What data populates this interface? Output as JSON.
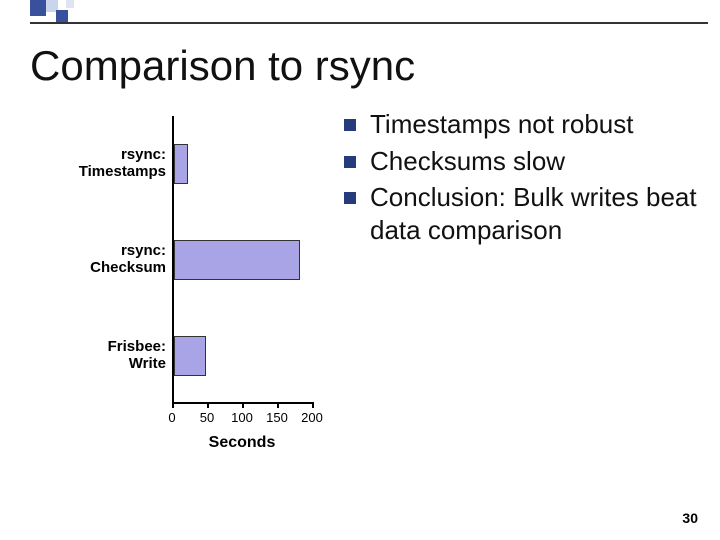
{
  "slide": {
    "title": "Comparison to rsync",
    "page_number": "30"
  },
  "bullets": [
    "Timestamps not robust",
    "Checksums slow",
    "Conclusion: Bulk writes beat data comparison"
  ],
  "chart_data": {
    "type": "bar",
    "orientation": "horizontal",
    "categories": [
      "rsync: Timestamps",
      "rsync: Checksum",
      "Frisbee: Write"
    ],
    "values": [
      20,
      180,
      45
    ],
    "xlabel": "Seconds",
    "ylabel": "",
    "xticks": [
      0,
      50,
      100,
      150,
      200
    ],
    "xlim": [
      0,
      200
    ]
  }
}
